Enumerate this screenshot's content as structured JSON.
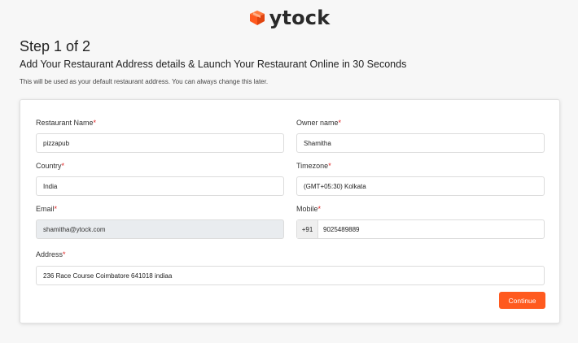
{
  "brand": {
    "name": "ytock",
    "icon": "cube-logo-icon",
    "accent": "#ff5a1f"
  },
  "header": {
    "step": "Step 1 of 2",
    "subtitle": "Add Your Restaurant Address details & Launch Your Restaurant Online in 30 Seconds",
    "helper": "This will be used as your default restaurant address. You can always change this later."
  },
  "form": {
    "restaurant_name": {
      "label": "Restaurant Name",
      "required": "*",
      "value": "pizzapub"
    },
    "owner_name": {
      "label": "Owner name",
      "required": "*",
      "value": "Shamitha"
    },
    "country": {
      "label": "Country",
      "required": "*",
      "value": "India"
    },
    "timezone": {
      "label": "Timezone",
      "required": "*",
      "value": "(GMT+05:30) Kolkata"
    },
    "email": {
      "label": "Email",
      "required": "*",
      "value": "shamitha@ytock.com"
    },
    "mobile": {
      "label": "Mobile",
      "required": "*",
      "prefix": "+91",
      "value": "9025489889"
    },
    "address": {
      "label": "Address",
      "required": "*",
      "value": "236 Race Course Coimbatore 641018 indiaa"
    },
    "continue_label": "Continue"
  }
}
